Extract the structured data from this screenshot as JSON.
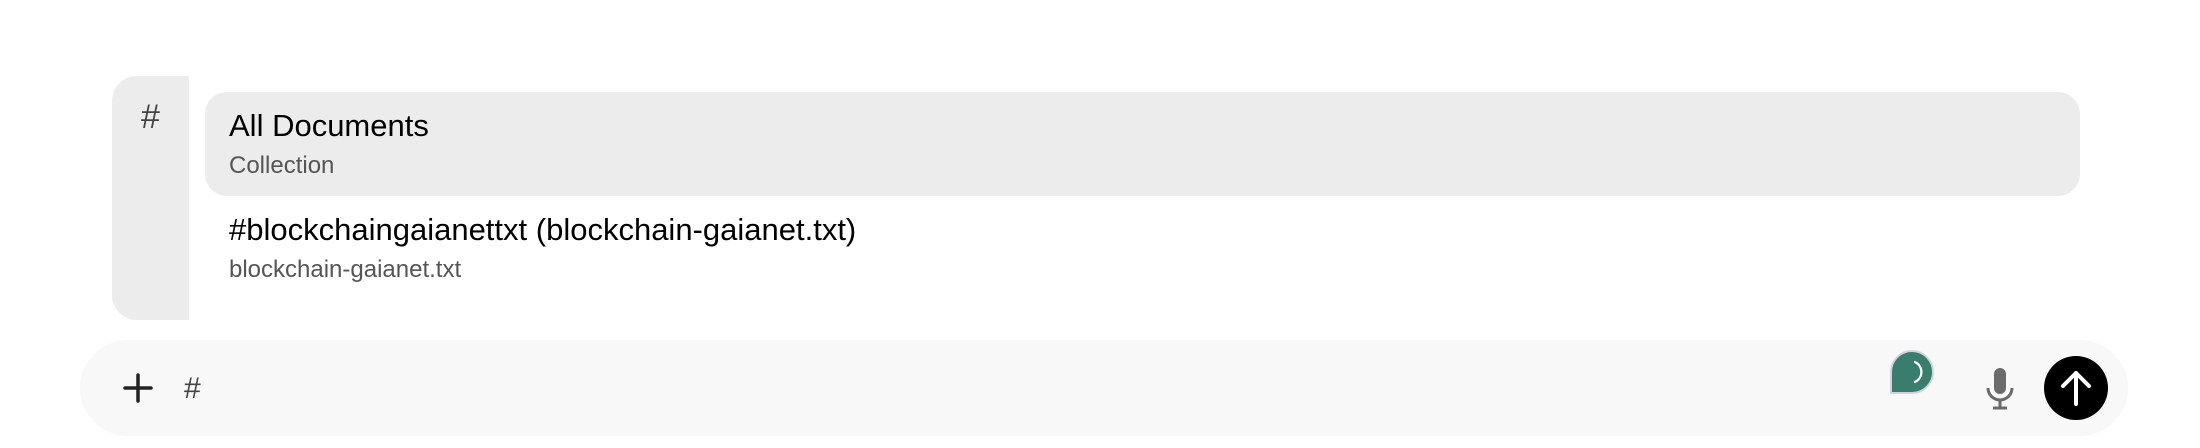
{
  "suggestions": {
    "trigger_symbol": "#",
    "items": [
      {
        "title": "All Documents",
        "subtitle": "Collection",
        "selected": true
      },
      {
        "title": "#blockchaingaianettxt (blockchain-gaianet.txt)",
        "subtitle": "blockchain-gaianet.txt",
        "selected": false
      }
    ]
  },
  "composer": {
    "input_value": "#",
    "icons": [
      "plus-icon",
      "grammar-assistant-icon",
      "microphone-icon",
      "arrow-up-icon"
    ],
    "send_button_color": "#000000",
    "assistant_icon_color": "#3a7d6c"
  }
}
